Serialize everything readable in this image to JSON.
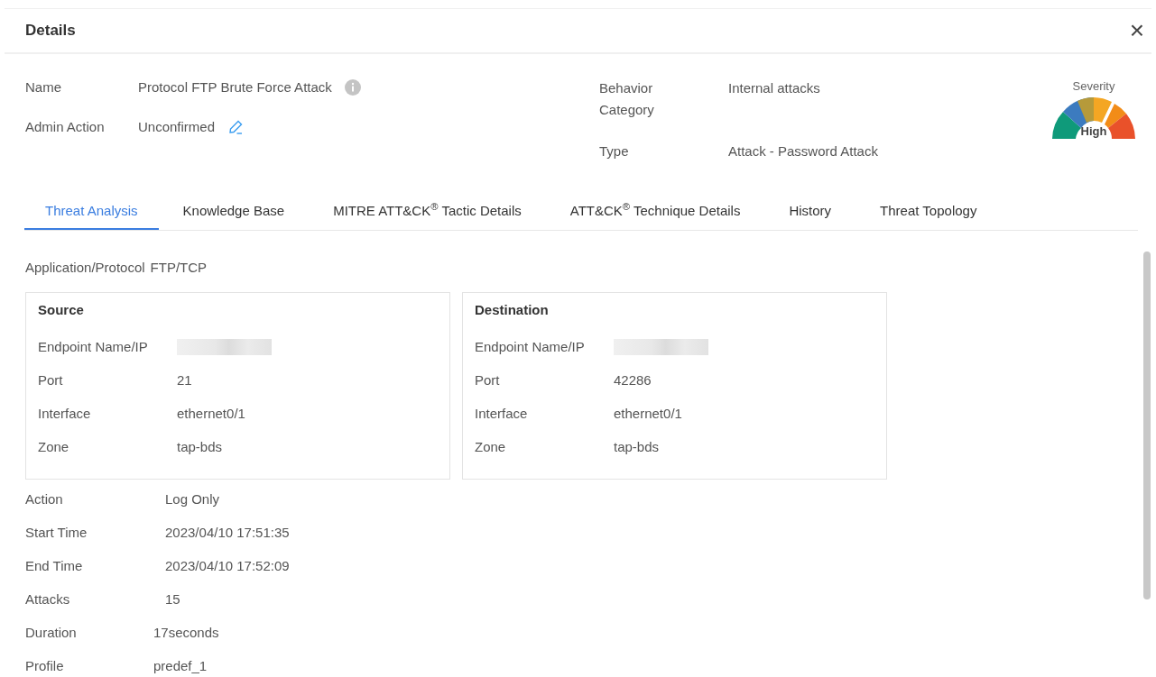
{
  "dialog": {
    "title": "Details",
    "close": "×"
  },
  "info_left": [
    {
      "label": "Name",
      "value": "Protocol FTP Brute Force Attack"
    },
    {
      "label": "Admin Action",
      "value": "Unconfirmed"
    }
  ],
  "info_right": [
    {
      "label": "Behavior Category",
      "value": "Internal attacks"
    },
    {
      "label": "Type",
      "value": "Attack - Password Attack"
    }
  ],
  "severity": {
    "label": "Severity",
    "value": "High"
  },
  "tabs": [
    {
      "label": "Threat Analysis",
      "selected": true
    },
    {
      "label": "Knowledge Base",
      "selected": false
    },
    {
      "label": "MITRE ATT&CK$^{®}$ Tactic Details",
      "selected": false
    },
    {
      "label": "ATT&CK$^{®}$ Technique Details",
      "selected": false
    },
    {
      "label": "History",
      "selected": false
    },
    {
      "label": "Threat Topology",
      "selected": false
    }
  ],
  "application_protocol": {
    "label": "Application/Protocol",
    "value": "FTP/TCP"
  },
  "panels": [
    {
      "title": "Source",
      "rows": [
        {
          "kind": "redacted",
          "label": "Endpoint Name/IP"
        },
        {
          "kind": "text",
          "label": "Port",
          "value": "21"
        },
        {
          "kind": "text",
          "label": "Interface",
          "value": "ethernet0/1"
        },
        {
          "kind": "text",
          "label": "Zone",
          "value": "tap-bds"
        }
      ]
    },
    {
      "title": "Destination",
      "rows": [
        {
          "kind": "redacted",
          "label": "Endpoint Name/IP"
        },
        {
          "kind": "text",
          "label": "Port",
          "value": "42286"
        },
        {
          "kind": "text",
          "label": "Interface",
          "value": "ethernet0/1"
        },
        {
          "kind": "text",
          "label": "Zone",
          "value": "tap-bds"
        }
      ]
    }
  ],
  "details": [
    {
      "label": "Action",
      "value": "Log Only"
    },
    {
      "label": "Start Time",
      "value": "2023/04/10 17:51:35"
    },
    {
      "label": "End Time",
      "value": "2023/04/10 17:52:09"
    },
    {
      "label": "Attacks",
      "value": "15"
    },
    {
      "label": "Duration",
      "value": "17seconds"
    },
    {
      "label": "Profile",
      "value": "predef_1"
    }
  ]
}
